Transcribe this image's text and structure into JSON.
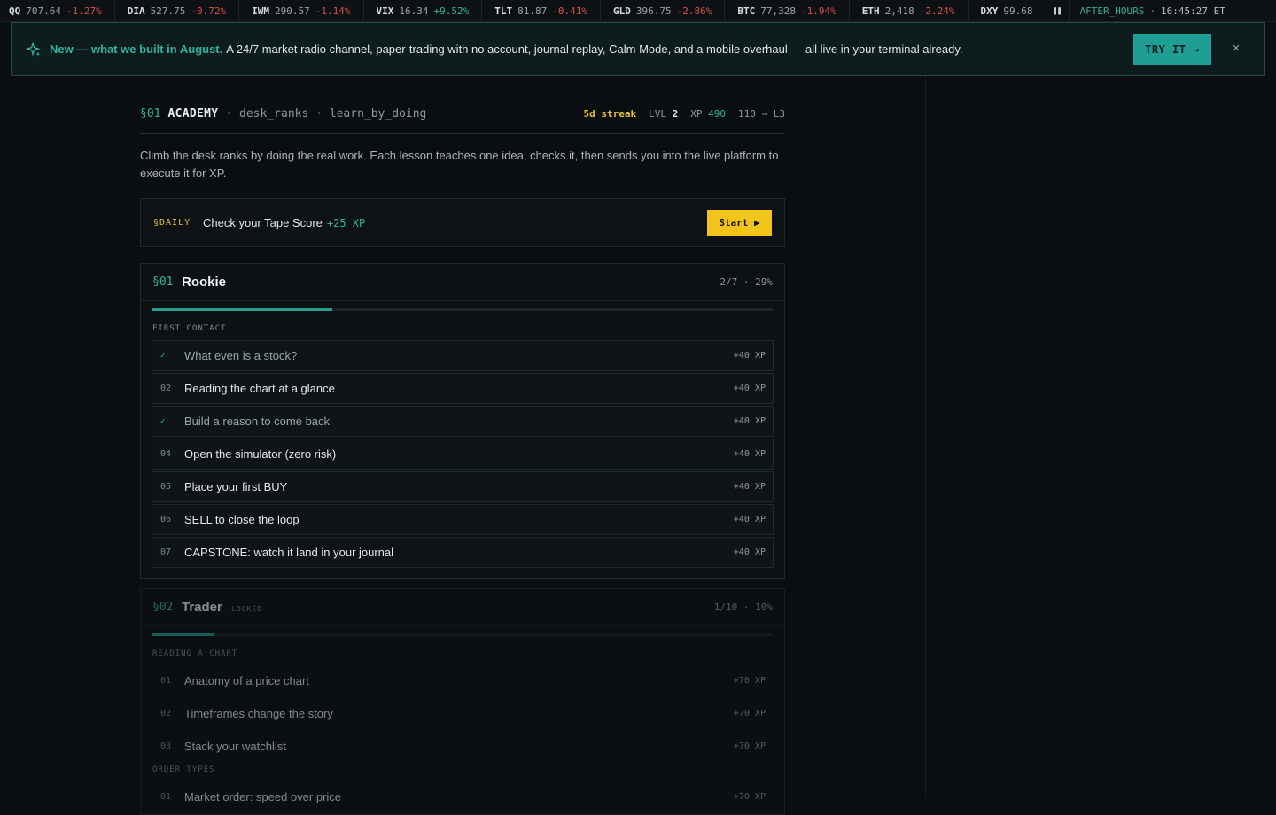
{
  "ticker": {
    "items": [
      {
        "sym": "QQ",
        "px": "707.64",
        "chg": "-1.27%",
        "dir": "dn"
      },
      {
        "sym": "DIA",
        "px": "527.75",
        "chg": "-0.72%",
        "dir": "dn"
      },
      {
        "sym": "IWM",
        "px": "290.57",
        "chg": "-1.14%",
        "dir": "dn"
      },
      {
        "sym": "VIX",
        "px": "16.34",
        "chg": "+9.52%",
        "dir": "up"
      },
      {
        "sym": "TLT",
        "px": "81.87",
        "chg": "-0.41%",
        "dir": "dn"
      },
      {
        "sym": "GLD",
        "px": "396.75",
        "chg": "-2.86%",
        "dir": "dn"
      },
      {
        "sym": "BTC",
        "px": "77,328",
        "chg": "-1.94%",
        "dir": "dn"
      },
      {
        "sym": "ETH",
        "px": "2,418",
        "chg": "-2.24%",
        "dir": "dn"
      },
      {
        "sym": "DXY",
        "px": "99.68",
        "chg": "",
        "dir": "flat"
      }
    ],
    "pause_icon": "pause-icon",
    "session": "AFTER_HOURS",
    "sep": "·",
    "time": "16:45:27 ET"
  },
  "banner": {
    "icon": "sparkle-icon",
    "lead": "New — what we built in August.",
    "text": "A 24/7 market radio channel, paper-trading with no account, journal replay, Calm Mode, and a mobile overhaul — all live in your terminal already.",
    "try_label": "TRY IT →",
    "close_label": "×"
  },
  "academy": {
    "sec": "§01",
    "title": "ACADEMY",
    "sub": "· desk_ranks · learn_by_doing",
    "streak": "5d streak",
    "lvl_label": "LVL",
    "lvl": "2",
    "xp_label": "XP",
    "xp": "490",
    "next": "110 → L3",
    "intro": "Climb the desk ranks by doing the real work. Each lesson teaches one idea, checks it, then sends you into the live platform to execute it for XP."
  },
  "daily": {
    "tag": "§DAILY",
    "text": "Check your Tape Score",
    "xp": "+25 XP",
    "start_label": "Start ▶"
  },
  "ranks": [
    {
      "sec": "§01",
      "name": "Rookie",
      "progress_text": "2/7 · 29%",
      "progress": 0.29,
      "locked": false,
      "groups": [
        {
          "label": "FIRST CONTACT",
          "lessons": [
            {
              "num": "✓",
              "title": "What even is a stock?",
              "xp": "+40 XP",
              "done": true
            },
            {
              "num": "02",
              "title": "Reading the chart at a glance",
              "xp": "+40 XP",
              "done": false
            },
            {
              "num": "✓",
              "title": "Build a reason to come back",
              "xp": "+40 XP",
              "done": true
            },
            {
              "num": "04",
              "title": "Open the simulator (zero risk)",
              "xp": "+40 XP",
              "done": false
            },
            {
              "num": "05",
              "title": "Place your first BUY",
              "xp": "+40 XP",
              "done": false
            },
            {
              "num": "06",
              "title": "SELL to close the loop",
              "xp": "+40 XP",
              "done": false
            },
            {
              "num": "07",
              "title": "CAPSTONE: watch it land in your journal",
              "xp": "+40 XP",
              "done": false
            }
          ]
        }
      ]
    },
    {
      "sec": "§02",
      "name": "Trader",
      "locked_label": "LOCKED",
      "progress_text": "1/10 · 10%",
      "progress": 0.1,
      "locked": true,
      "groups": [
        {
          "label": "READING A CHART",
          "lessons": [
            {
              "num": "01",
              "title": "Anatomy of a price chart",
              "xp": "+70 XP",
              "done": false
            },
            {
              "num": "02",
              "title": "Timeframes change the story",
              "xp": "+70 XP",
              "done": false
            },
            {
              "num": "03",
              "title": "Stack your watchlist",
              "xp": "+70 XP",
              "done": false
            }
          ]
        },
        {
          "label": "ORDER TYPES",
          "lessons": [
            {
              "num": "01",
              "title": "Market order: speed over price",
              "xp": "+70 XP",
              "done": false
            }
          ]
        }
      ]
    }
  ]
}
